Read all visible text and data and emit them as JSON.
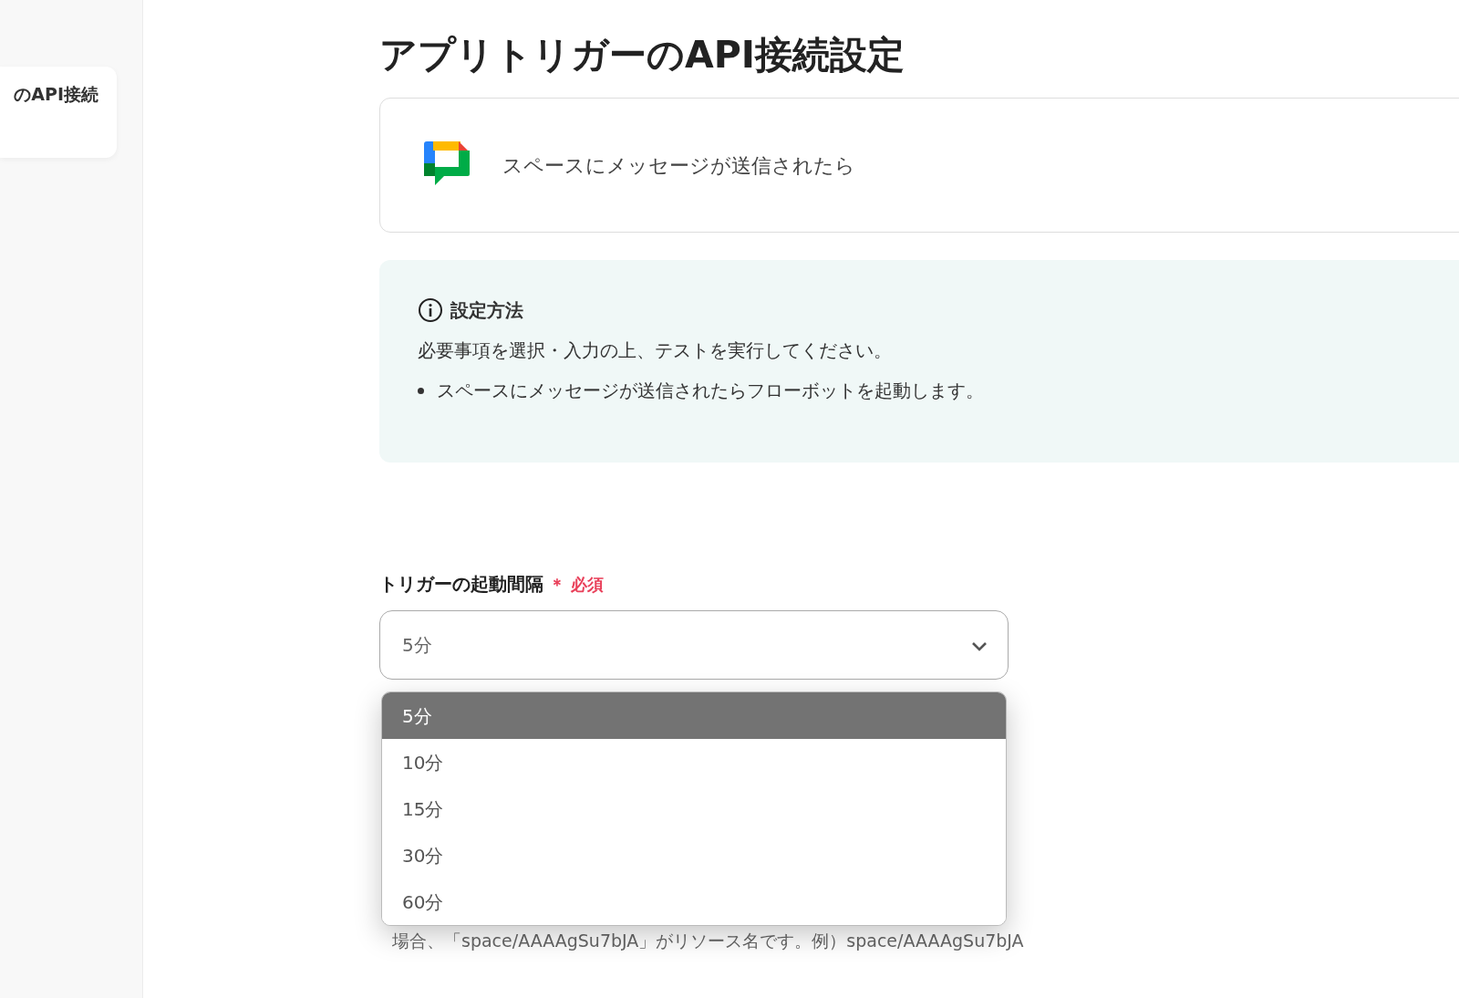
{
  "sidebar": {
    "items": [
      {
        "label": "のAPI接続",
        "selected": true
      }
    ]
  },
  "page_title": "アプリトリガーのAPI接続設定",
  "trigger": {
    "label": "スペースにメッセージが送信されたら"
  },
  "info": {
    "heading": "設定方法",
    "text": "必要事項を選択・入力の上、テストを実行してください。",
    "bullets": [
      "スペースにメッセージが送信されたらフローボットを起動します。"
    ]
  },
  "interval_field": {
    "label": "トリガーの起動間隔",
    "required_mark": "＊",
    "required_text": "必須",
    "value": "5分",
    "expanded": true,
    "options": [
      {
        "label": "5分",
        "selected": true
      },
      {
        "label": "10分",
        "selected": false
      },
      {
        "label": "15分",
        "selected": false
      },
      {
        "label": "30分",
        "selected": false
      },
      {
        "label": "60分",
        "selected": false
      }
    ]
  },
  "space_field": {
    "hint": "場合、「space/AAAAgSu7bJA」がリソース名です。例）space/AAAAgSu7bJA"
  }
}
